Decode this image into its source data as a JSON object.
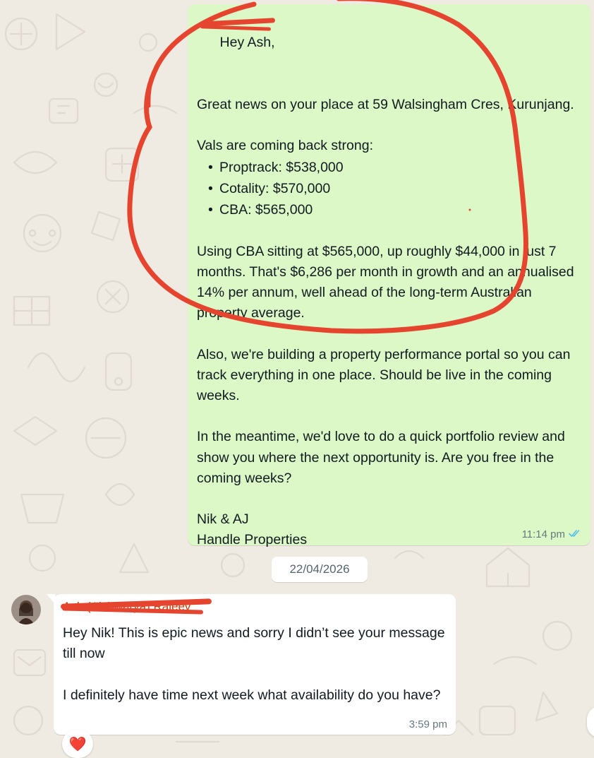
{
  "outgoing_message": {
    "greeting": "Hey Ash,",
    "paragraph_1": "Great news on your place at 59 Walsingham Cres, Kurunjang.",
    "paragraph_2": "Vals are coming back strong:",
    "valuations": [
      "Proptrack: $538,000",
      "Cotality: $570,000",
      "CBA: $565,000"
    ],
    "paragraph_3": "Using CBA sitting at $565,000, up roughly $44,000 in just 7 months. That's $6,286 per month in growth and an annualised 14% per annum, well ahead of the long-term Australian property average.",
    "paragraph_4": "Also, we're building a property performance portal so you can track everything in one place. Should be live in the coming weeks.",
    "paragraph_5": "In the meantime, we'd love to do a quick portfolio review and show you where the next opportunity is. Are you free in the coming weeks?",
    "signature_line_1": "Nik & AJ",
    "signature_line_2": "Handle Properties",
    "time": "11:14 pm",
    "status_icon": "double-check-read-icon",
    "bubble_color": "#dcf8c6"
  },
  "date_separator": "22/04/2026",
  "incoming_message": {
    "sender": "Ash (Aishwarya) Rajeev",
    "paragraph_1": "Hey Nik! This is epic news and sorry I didn’t see your message till now",
    "paragraph_2": "I definitely have time next week what availability do you have?",
    "time": "3:59 pm",
    "reaction": "❤️",
    "avatar_icon": "contact-photo"
  },
  "colors": {
    "wallpaper": "#efeae2",
    "annotation_red": "#e5452f",
    "read_ticks": "#53bdeb",
    "meta_text": "#667781"
  }
}
